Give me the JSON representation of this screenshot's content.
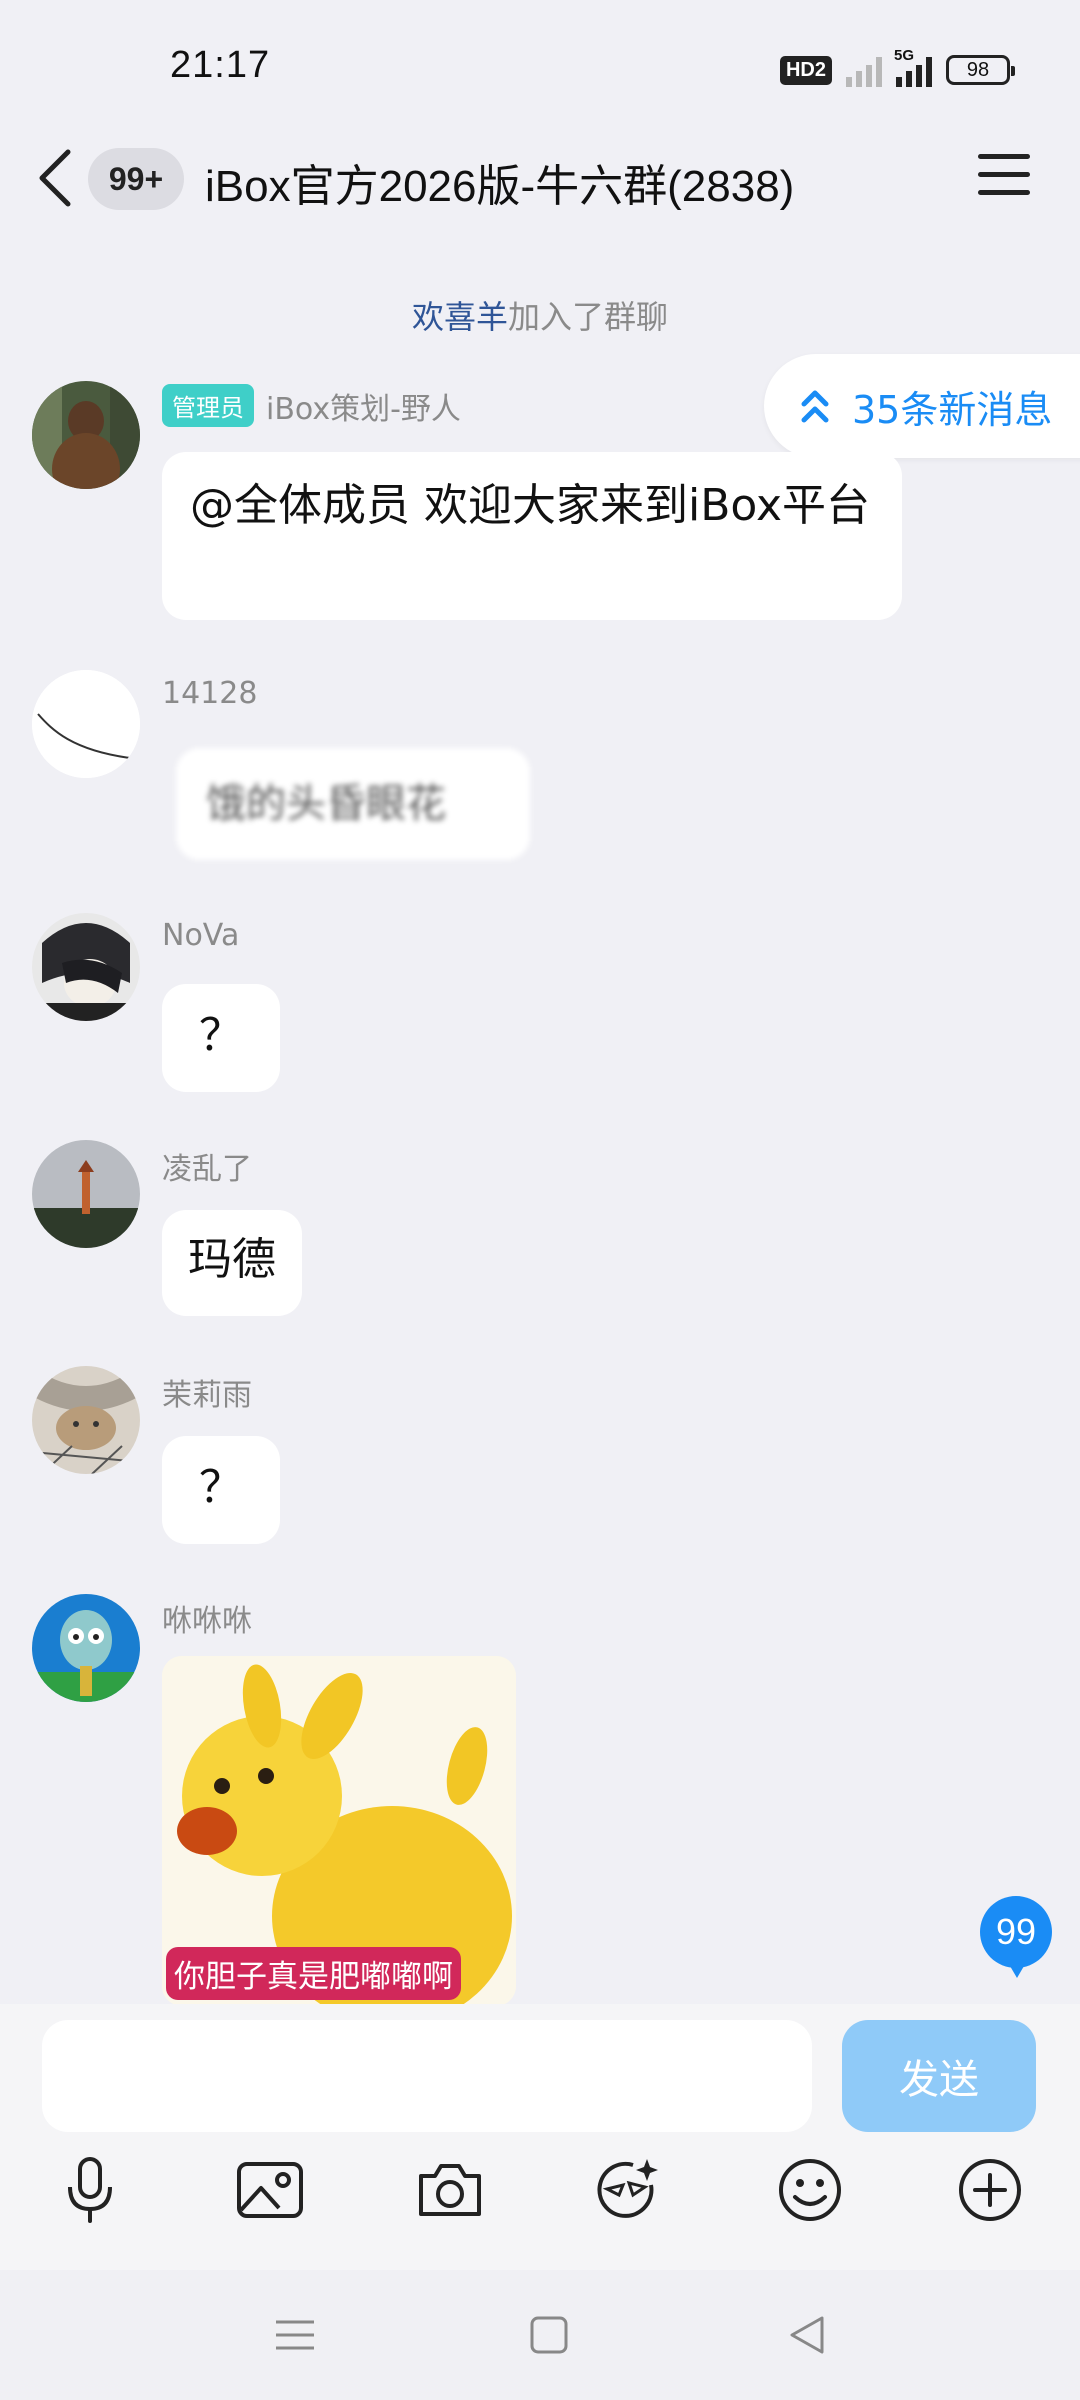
{
  "status_bar": {
    "time": "21:17",
    "hd_label": "HD2",
    "network_label": "5G",
    "battery": "98"
  },
  "header": {
    "unread_count": "99+",
    "title": "iBox官方2026版-牛六群(2838)"
  },
  "system_message": {
    "name": "欢喜羊",
    "text": "加入了群聊"
  },
  "new_messages_pill": {
    "label": "35条新消息"
  },
  "messages": [
    {
      "badge": "管理员",
      "sender": "iBox策划-野人",
      "text": "@全体成员 欢迎大家来到iBox平台"
    },
    {
      "sender": "14128",
      "text": "饿的头昏眼花"
    },
    {
      "sender": "NoVa",
      "text": "？"
    },
    {
      "sender": "凌乱了",
      "text": "玛德"
    },
    {
      "sender": "茉莉雨",
      "text": "？"
    },
    {
      "sender": "咻咻咻",
      "sticker_caption": "你胆子真是肥嘟嘟啊"
    }
  ],
  "floating_badge": "99",
  "input": {
    "send_label": "发送"
  },
  "toolbar": {
    "icons": [
      "microphone-icon",
      "image-icon",
      "camera-icon",
      "smart-face-icon",
      "emoji-icon",
      "plus-icon"
    ]
  },
  "colors": {
    "accent": "#1a8cf5",
    "send_disabled": "#8fcaf8",
    "admin_badge": "#3fcfc8",
    "background": "#f0f0f5"
  }
}
